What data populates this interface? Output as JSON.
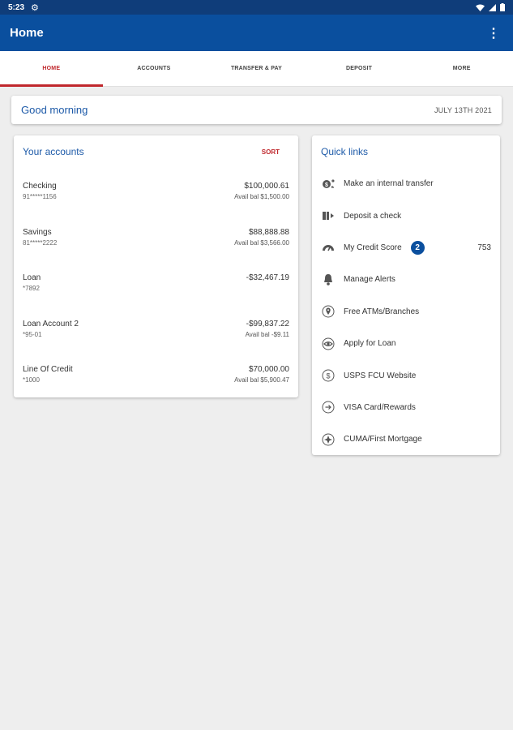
{
  "status": {
    "time": "5:23"
  },
  "appbar": {
    "title": "Home",
    "menu_glyph": "⋮"
  },
  "tabs": [
    {
      "label": "HOME",
      "active": true
    },
    {
      "label": "ACCOUNTS"
    },
    {
      "label": "TRANSFER & PAY"
    },
    {
      "label": "DEPOSIT"
    },
    {
      "label": "MORE"
    }
  ],
  "greeting": {
    "text": "Good morning",
    "date": "JULY 13TH 2021"
  },
  "accounts": {
    "title": "Your accounts",
    "sort_label": "SORT",
    "items": [
      {
        "name": "Checking",
        "number": "91*****1156",
        "balance": "$100,000.61",
        "avail": "Avail bal $1,500.00"
      },
      {
        "name": "Savings",
        "number": "81*****2222",
        "balance": "$88,888.88",
        "avail": "Avail bal $3,566.00"
      },
      {
        "name": "Loan",
        "number": "*7892",
        "balance": "-$32,467.19",
        "avail": ""
      },
      {
        "name": "Loan Account 2",
        "number": "*95-01",
        "balance": "-$99,837.22",
        "avail": "Avail bal -$9.11"
      },
      {
        "name": "Line Of Credit",
        "number": "*1000",
        "balance": "$70,000.00",
        "avail": "Avail bal $5,900.47"
      }
    ]
  },
  "quick_links": {
    "title": "Quick links",
    "items": [
      {
        "label": "Make an internal transfer",
        "icon": "transfer-icon"
      },
      {
        "label": "Deposit a check",
        "icon": "check-deposit-icon"
      },
      {
        "label": "My Credit Score",
        "icon": "gauge-icon",
        "badge": "2",
        "value": "753"
      },
      {
        "label": "Manage Alerts",
        "icon": "bell-icon"
      },
      {
        "label": "Free ATMs/Branches",
        "icon": "location-pin-icon"
      },
      {
        "label": "Apply for Loan",
        "icon": "eye-icon"
      },
      {
        "label": "USPS FCU Website",
        "icon": "dollar-icon"
      },
      {
        "label": "VISA Card/Rewards",
        "icon": "arrow-right-icon"
      },
      {
        "label": "CUMA/First Mortgage",
        "icon": "compass-icon"
      }
    ]
  },
  "colors": {
    "primary": "#0a4f9e",
    "status_bar": "#0f3d7a",
    "accent_red": "#c0282d",
    "link_blue": "#1d5aa8"
  }
}
